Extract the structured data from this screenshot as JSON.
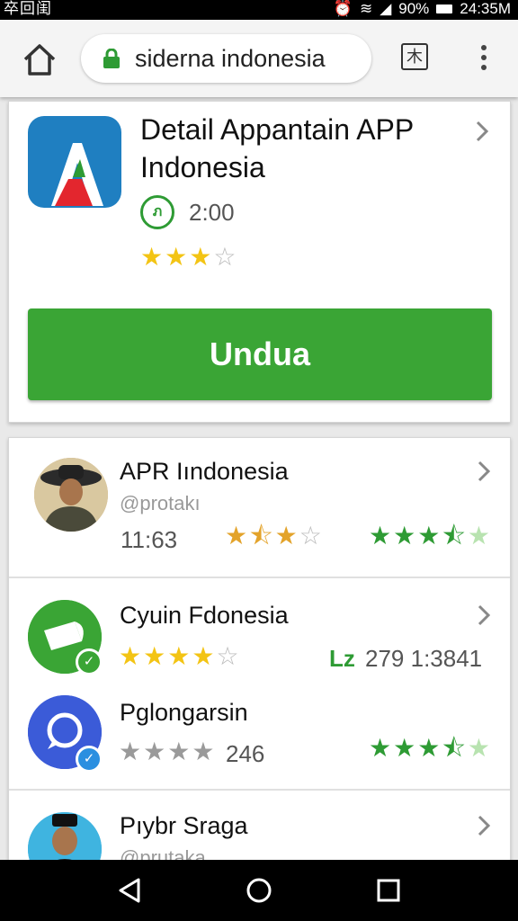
{
  "status_bar": {
    "left_text": "卒回闺",
    "battery": "90%",
    "time": "24:35M"
  },
  "browser": {
    "url": "siderna indonesia",
    "tabs_glyph": "木"
  },
  "featured": {
    "title": "Detail Appantain APP Indonesia",
    "badge_text": "ภ",
    "time": "2:00",
    "rating": 3,
    "download_label": "Undua"
  },
  "list": [
    {
      "name": "APR Iındonesia",
      "handle": "@protakı",
      "time": "11:63",
      "rating_left": 2.5,
      "rating_right": 3.5
    },
    {
      "name": "Cyuin Fdonesia",
      "rating": 4,
      "count_icon": "Lz",
      "stats": "279 1:3841"
    },
    {
      "name": "Pglongarsin",
      "rating": 4,
      "count": "246",
      "rating_right": 3.5
    },
    {
      "name": "Pıybr Sraga",
      "handle": "@prutaka"
    }
  ],
  "icons": [
    "wifi-icon",
    "signal-icon",
    "battery-icon",
    "home-icon",
    "lock-icon",
    "tabs-icon",
    "menu-icon",
    "chevron-right-icon",
    "star-icon",
    "back-icon",
    "home-circle-icon",
    "recents-icon",
    "check-badge-icon"
  ],
  "colors": {
    "accent_green": "#3aa535",
    "star_gold": "#f3c414",
    "star_green": "#2e9b34",
    "url_lock": "#2e9b34"
  }
}
